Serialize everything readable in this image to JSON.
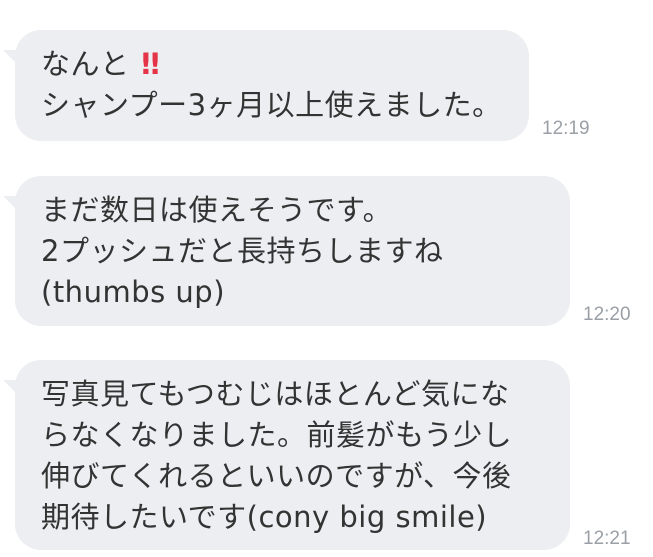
{
  "messages": [
    {
      "lines": [
        "なんと",
        "シャンプー3ヶ月以上使えました。"
      ],
      "emphasis": "!!",
      "time": "12:19"
    },
    {
      "lines": [
        "まだ数日は使えそうです。",
        "2プッシュだと長持ちしますね",
        "(thumbs up)"
      ],
      "time": "12:20"
    },
    {
      "lines": [
        "写真見てもつむじはほとんど気にな",
        "らなくなりました。前髪がもう少し",
        "伸びてくれるといいのですが、今後",
        "期待したいです(cony big smile)"
      ],
      "time": "12:21"
    }
  ],
  "colors": {
    "bubble": "#eceef1",
    "text": "#333333",
    "emphasis": "#e53347",
    "timestamp": "#9aa0a6"
  }
}
